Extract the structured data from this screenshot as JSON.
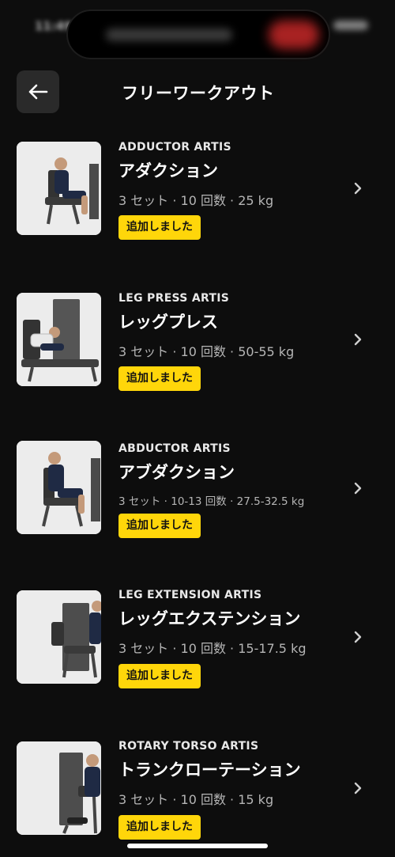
{
  "status_bar": {
    "time": "11:49"
  },
  "header": {
    "title": "フリーワークアウト",
    "back_icon": "arrow-left-icon"
  },
  "colors": {
    "background": "#0d0d0d",
    "badge": "#ffd60a",
    "badge_text": "#111111"
  },
  "workouts": [
    {
      "brand": "ADDUCTOR ARTIS",
      "name": "アダクション",
      "details": "3 セット · 10 回数 · 25 kg",
      "badge": "追加しました"
    },
    {
      "brand": "LEG PRESS ARTIS",
      "name": "レッグプレス",
      "details": "3 セット · 10 回数 · 50-55 kg",
      "badge": "追加しました"
    },
    {
      "brand": "ABDUCTOR ARTIS",
      "name": "アブダクション",
      "details": "3 セット · 10-13 回数 · 27.5-32.5 kg",
      "badge": "追加しました"
    },
    {
      "brand": "LEG EXTENSION ARTIS",
      "name": "レッグエクステンション",
      "details": "3 セット · 10 回数 · 15-17.5 kg",
      "badge": "追加しました"
    },
    {
      "brand": "ROTARY TORSO ARTIS",
      "name": "トランクローテーション",
      "details": "3 セット · 10 回数 · 15 kg",
      "badge": "追加しました"
    }
  ]
}
